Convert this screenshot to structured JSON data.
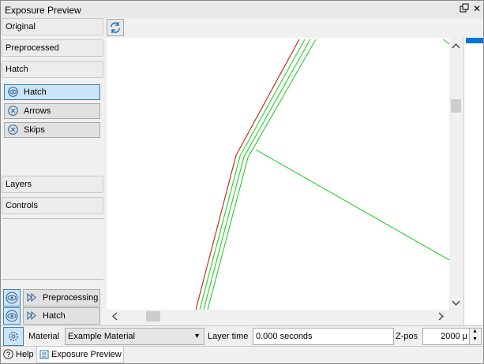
{
  "window": {
    "title": "Exposure Preview"
  },
  "sidebar": {
    "sections": [
      {
        "label": "Original"
      },
      {
        "label": "Preprocessed"
      },
      {
        "label": "Hatch"
      },
      {
        "label": "Layers"
      },
      {
        "label": "Controls"
      }
    ],
    "hatch_toggles": [
      {
        "label": "Hatch",
        "icon": "eye-icon",
        "checked": true
      },
      {
        "label": "Arrows",
        "icon": "circle-x-icon",
        "checked": false
      },
      {
        "label": "Skips",
        "icon": "circle-x-icon",
        "checked": false
      }
    ],
    "bottom_rows": [
      {
        "label": "Preprocessing"
      },
      {
        "label": "Hatch"
      }
    ]
  },
  "toolbar": {
    "refresh_icon": "refresh-icon"
  },
  "bottom": {
    "material_label": "Material",
    "material_value": "Example Material",
    "layer_time_label": "Layer time",
    "layer_time_value": "0.000 seconds",
    "zpos_label": "Z-pos",
    "zpos_value": "2000 µ"
  },
  "tabs": [
    {
      "label": "Help",
      "icon": "help-icon"
    },
    {
      "label": "Exposure Preview",
      "icon": "list-icon",
      "active": true
    }
  ],
  "colors": {
    "contour": "#cc0000",
    "hatch": "#00cc00",
    "accent": "#0078d7",
    "selected": "#cce4f7"
  }
}
